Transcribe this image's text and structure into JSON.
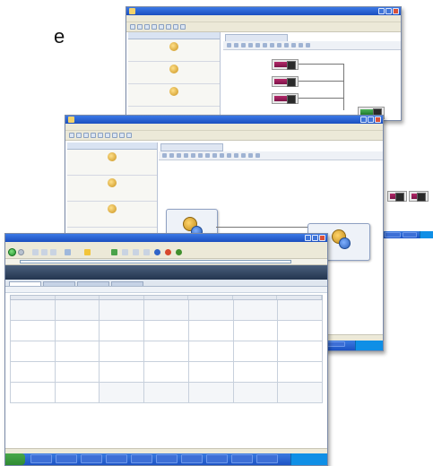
{
  "slide_text": "e",
  "colors": {
    "xp_title": "#2461d6",
    "taskbar": "#2a62d2",
    "node_magenta": "#a3215c",
    "node_green": "#2f8f3d",
    "cal_banner": "#34465f"
  },
  "window_back": {
    "left_panel_items": [
      "",
      "",
      ""
    ],
    "node_count": 5
  },
  "window_mid": {
    "left_panel_items": [
      "",
      "",
      ""
    ]
  },
  "window_front": {
    "icons": [
      "back-icon",
      "forward-icon",
      "stop-icon",
      "refresh-icon",
      "home-icon",
      "search-icon",
      "favorites-icon",
      "media-icon",
      "history-icon",
      "mail-icon",
      "print-icon"
    ],
    "calendar_weekdays": [
      "",
      "",
      "",
      "",
      "",
      "",
      ""
    ],
    "calendar_rows": 5
  }
}
